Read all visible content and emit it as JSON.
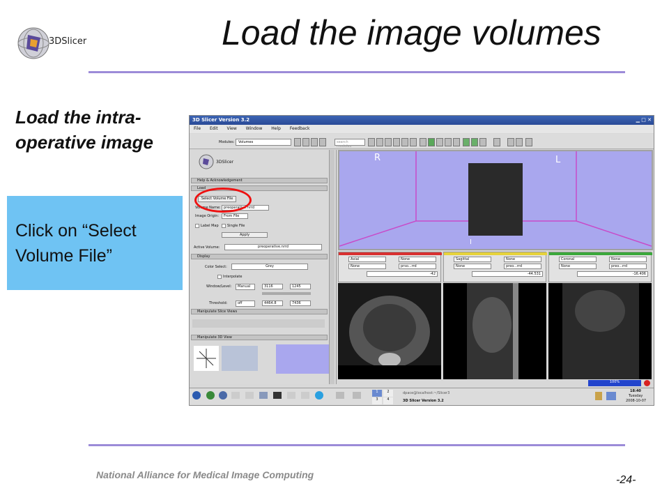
{
  "slide": {
    "title": "Load the image volumes",
    "subheading": "Load the intra-operative image",
    "callout": "Click on “Select Volume File”",
    "footer": "National Alliance for Medical Image Computing",
    "page_number": "-24-",
    "logo_text": "3DSlicer",
    "accent_line_color": "#9c8bd8",
    "callout_color": "#6fc3f3"
  },
  "app": {
    "window_title": "3D Slicer Version 3.2",
    "menu": [
      "File",
      "Edit",
      "View",
      "Window",
      "Help",
      "Feedback"
    ],
    "modules_label": "Modules:",
    "module_selected": "Volumes",
    "search_placeholder": "search modules",
    "logo_text": "3DSlicer",
    "panel": {
      "help_section": "Help & Acknowledgement",
      "load_section": "Load",
      "select_volume_button": "Select Volume File",
      "volume_name_label": "Volume Name:",
      "volume_name_value": "preoperative.nrrd",
      "image_origin_label": "Image Origin:",
      "image_origin_value": "From File",
      "label_map": "Label Map",
      "single_file": "Single File",
      "apply_button": "Apply",
      "active_volume_label": "Active Volume:",
      "active_volume_value": "preoperative.nrrd",
      "display_section": "Display",
      "color_select_label": "Color Select:",
      "color_select_value": "Grey",
      "interpolate": "Interpolate",
      "window_level_label": "Window/Level:",
      "window_level_mode": "Manual",
      "window_value": "3116",
      "level_value": "1245",
      "threshold_label": "Threshold:",
      "threshold_mode": "off",
      "threshold_low": "4464.8",
      "threshold_high": "7436",
      "manipulate_slice_section": "Manipulate Slice Views",
      "manipulate_3d_section": "Manipulate 3D View"
    },
    "view3d": {
      "label_r": "R",
      "label_l": "L",
      "label_i": "I"
    },
    "slices": [
      {
        "orientation": "Axial",
        "fg": "None",
        "bg": "None",
        "lbl": "prso...rrd",
        "offset": "-42",
        "color": "#d83030"
      },
      {
        "orientation": "Sagittal",
        "fg": "None",
        "bg": "None",
        "lbl": "preo...rrd",
        "offset": "-44.531",
        "color": "#e6d23a"
      },
      {
        "orientation": "Coronal",
        "fg": "None",
        "bg": "None",
        "lbl": "preo...rrd",
        "offset": "-16.406",
        "color": "#3aa83a"
      }
    ],
    "progress": "100%",
    "taskbar": {
      "workspaces": [
        "1",
        "2",
        "3",
        "4"
      ],
      "task1": "dpace@localhost:~/Slicer3",
      "task2": "3D Slicer Version 3.2",
      "time": "18:40",
      "day": "Tuesday",
      "date": "2008-10-07"
    }
  }
}
